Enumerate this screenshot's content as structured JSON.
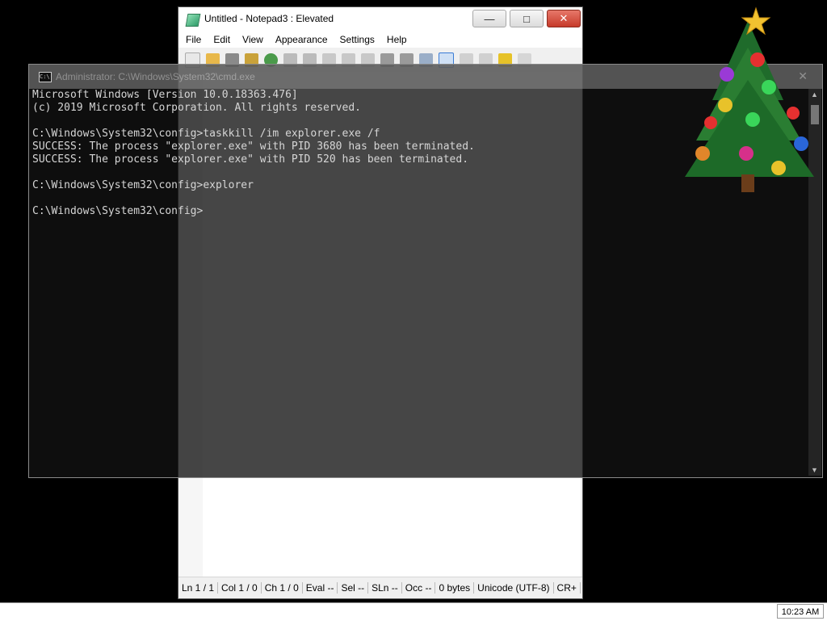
{
  "notepad": {
    "title": "Untitled - Notepad3 : Elevated",
    "menu": [
      "File",
      "Edit",
      "View",
      "Appearance",
      "Settings",
      "Help"
    ],
    "status": {
      "ln": "Ln 1 / 1",
      "col": "Col 1 / 0",
      "ch": "Ch 1 / 0",
      "eval": "Eval --",
      "sel": "Sel --",
      "sln": "SLn --",
      "occ": "Occ --",
      "size": "0 bytes",
      "encoding": "Unicode (UTF-8)",
      "eol": "CR+"
    }
  },
  "cmd": {
    "title": "Administrator: C:\\Windows\\System32\\cmd.exe",
    "lines": [
      "Microsoft Windows [Version 10.0.18363.476]",
      "(c) 2019 Microsoft Corporation. All rights reserved.",
      "",
      "C:\\Windows\\System32\\config>taskkill /im explorer.exe /f",
      "SUCCESS: The process \"explorer.exe\" with PID 3680 has been terminated.",
      "SUCCESS: The process \"explorer.exe\" with PID 520 has been terminated.",
      "",
      "C:\\Windows\\System32\\config>explorer",
      "",
      "C:\\Windows\\System32\\config>"
    ]
  },
  "taskbar": {
    "clock": "10:23 AM"
  }
}
